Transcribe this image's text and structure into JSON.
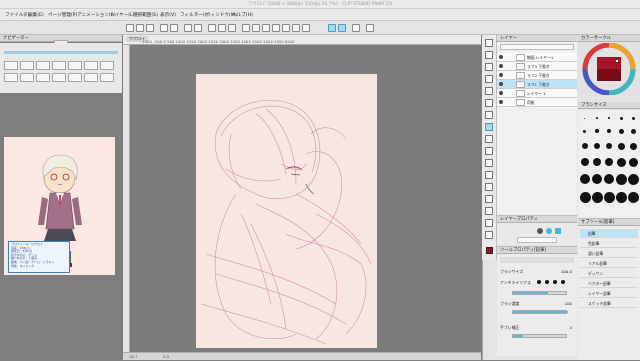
{
  "window": {
    "title": "ワクロイ [2000 x 3000px 350dpi 16.7%] - CLIP STUDIO PAINT EX"
  },
  "menu": [
    "ファイル(F)",
    "編集(E)",
    "ページ管理(P)",
    "アニメーション(A)",
    "レイヤー(L)",
    "選択範囲(S)",
    "表示(V)",
    "フィルター(I)",
    "ウィンドウ(W)",
    "ヘルプ(H)"
  ],
  "left_panel": {
    "header": "ナビゲーター",
    "notes_lines": [
      "プロフィール・ワクロイ",
      "身長：158cm",
      "誕生日：3月5日",
      "好きなもの：ゲーム",
      "嫌いなもの：人混み",
      "趣味：ペン画・ゲーム・イラスト",
      "特技：タイピング"
    ]
  },
  "canvas": {
    "tab": "ワクロイ",
    "ruler_ticks": "-1000  -500   0    500  1000  1500  2000  2500  3000  3500  4000  4500  5000  5500  6000"
  },
  "layers": {
    "header": "レイヤー",
    "rows": [
      {
        "label": "線画 レイヤー1"
      },
      {
        "label": "ラフ3 下書き"
      },
      {
        "label": "ラフ2 下書き"
      },
      {
        "label": "ラフ1 下書き"
      },
      {
        "label": "レイヤー 1"
      },
      {
        "label": "用紙"
      }
    ]
  },
  "color_panel": {
    "header": "カラーサークル",
    "accent": "#a40e22"
  },
  "brush_panel": {
    "header": "ブラシサイズ"
  },
  "subview": {
    "header": "レイヤープロパティ"
  },
  "tool_property": {
    "header": "ツールプロパティ[鉛筆]",
    "rows": [
      {
        "label": "ブラシサイズ",
        "value": "100.0"
      },
      {
        "label": "アンチエイリアス",
        "value": ""
      },
      {
        "label": "ブラシ濃度",
        "value": "100"
      },
      {
        "label": "手ブレ補正",
        "value": "4"
      }
    ]
  },
  "sub_tool": {
    "header": "サブツール[鉛筆]",
    "items": [
      {
        "label": "鉛筆"
      },
      {
        "label": "色鉛筆"
      },
      {
        "label": "濃い鉛筆"
      },
      {
        "label": "リアル鉛筆"
      },
      {
        "label": "デッサン"
      },
      {
        "label": "ベクター鉛筆"
      },
      {
        "label": "レイヤー鉛筆"
      },
      {
        "label": "スケッチ鉛筆"
      }
    ]
  },
  "status": {
    "zoom": "16.7",
    "angle": "0.0"
  }
}
